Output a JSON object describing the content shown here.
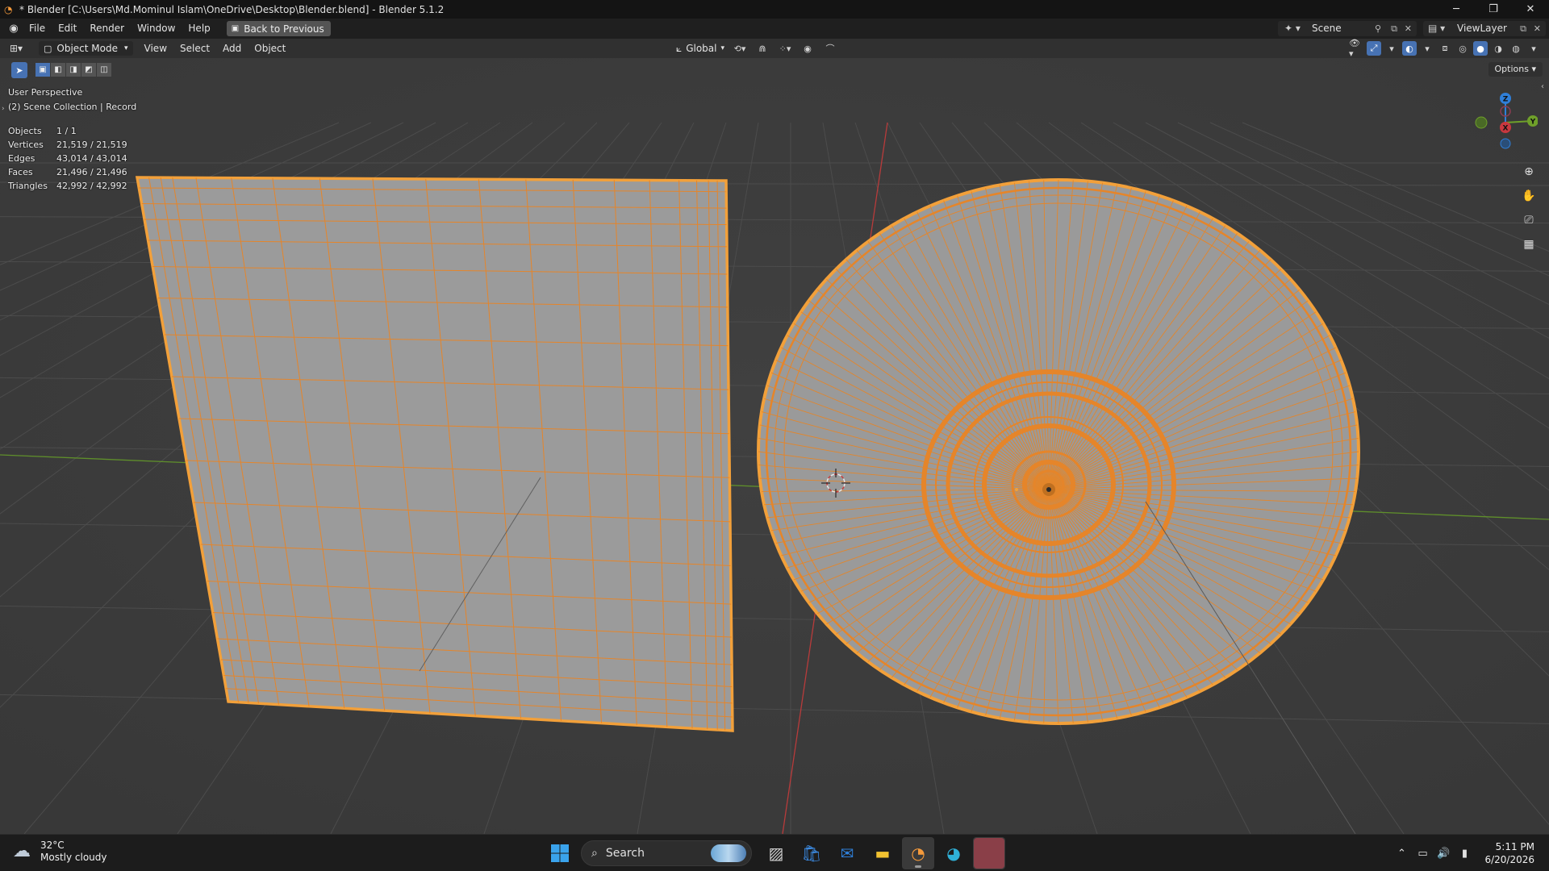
{
  "window": {
    "title": "* Blender [C:\\Users\\Md.Mominul Islam\\OneDrive\\Desktop\\Blender.blend] - Blender 5.1.2",
    "controls": [
      "minimize-icon",
      "restore-icon",
      "close-icon"
    ]
  },
  "menubar": {
    "items": [
      "File",
      "Edit",
      "Render",
      "Window",
      "Help"
    ],
    "back_button": "Back to Previous",
    "scene_name": "Scene",
    "view_layer": "ViewLayer"
  },
  "viewport_header": {
    "mode": "Object Mode",
    "menus": [
      "View",
      "Select",
      "Add",
      "Object"
    ],
    "transform_orientation": "Global",
    "options": "Options"
  },
  "overlay": {
    "perspective": "User Perspective",
    "collection": "(2) Scene Collection | Record",
    "stats": [
      {
        "label": "Objects",
        "value": "1 / 1"
      },
      {
        "label": "Vertices",
        "value": "21,519 / 21,519"
      },
      {
        "label": "Edges",
        "value": "43,014 / 43,014"
      },
      {
        "label": "Faces",
        "value": "21,496 / 21,496"
      },
      {
        "label": "Triangles",
        "value": "42,992 / 42,992"
      }
    ]
  },
  "gizmo": {
    "z": "Z",
    "y": "Y",
    "x": "X"
  },
  "colors": {
    "selection_orange": "#f09030",
    "mesh_gray": "#9b9b9b",
    "x_axis": "#c8383f",
    "y_axis": "#6fa02a",
    "z_axis": "#2f7fd9",
    "accent": "#4772b3"
  },
  "taskbar": {
    "weather_temp": "32°C",
    "weather_desc": "Mostly cloudy",
    "search_placeholder": "Search",
    "time": "5:11 PM",
    "date": "6/20/2026"
  }
}
